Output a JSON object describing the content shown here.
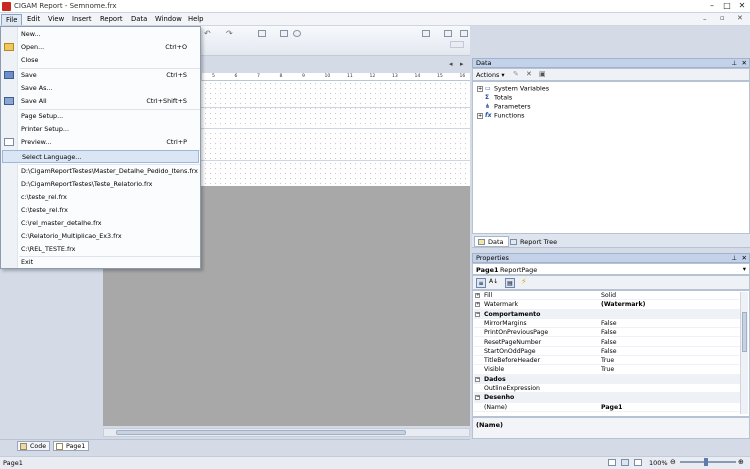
{
  "window": {
    "title": "CIGAM Report - Semnome.frx"
  },
  "menubar": {
    "items": [
      "File",
      "Edit",
      "View",
      "Insert",
      "Report",
      "Data",
      "Window",
      "Help"
    ]
  },
  "file_menu": {
    "items": [
      {
        "label": "New...",
        "shortcut": ""
      },
      {
        "label": "Open...",
        "shortcut": "Ctrl+O"
      },
      {
        "label": "Close",
        "shortcut": ""
      },
      {
        "label": "Save",
        "shortcut": "Ctrl+S"
      },
      {
        "label": "Save As...",
        "shortcut": ""
      },
      {
        "label": "Save All",
        "shortcut": "Ctrl+Shift+S"
      },
      {
        "label": "Page Setup...",
        "shortcut": ""
      },
      {
        "label": "Printer Setup...",
        "shortcut": ""
      },
      {
        "label": "Preview...",
        "shortcut": "Ctrl+P"
      },
      {
        "label": "Select Language...",
        "shortcut": ""
      }
    ],
    "recent": [
      "D:\\CigamReportTestes\\Master_Detalhe_Pedido_Itens.frx",
      "D:\\CigamReportTestes\\Teste_Relatorio.frx",
      "c:\\teste_rel.frx",
      "C:\\teste_rel.frx",
      "C:\\rel_master_detalhe.frx",
      "C:\\Relatorio_Multiplicao_Ex3.frx",
      "C:\\REL_TESTE.frx"
    ],
    "exit": "Exit"
  },
  "ruler": {
    "ticks": [
      "5",
      "6",
      "7",
      "8",
      "9",
      "10",
      "11",
      "12",
      "13",
      "14",
      "15",
      "16"
    ]
  },
  "data_panel": {
    "title": "Data",
    "actions_label": "Actions",
    "tree": [
      "System Variables",
      "Totals",
      "Parameters",
      "Functions"
    ]
  },
  "bottom_tabs": {
    "data": "Data",
    "report_tree": "Report Tree"
  },
  "properties": {
    "title": "Properties",
    "object_name": "Page1",
    "object_type": "ReportPage",
    "rows": [
      {
        "name": "Fill",
        "value": "Solid",
        "kind": "expand"
      },
      {
        "name": "Watermark",
        "value": "(Watermark)",
        "kind": "expand",
        "bold": true
      },
      {
        "name": "Comportamento",
        "value": "",
        "kind": "cat"
      },
      {
        "name": "MirrorMargins",
        "value": "False",
        "kind": "prop"
      },
      {
        "name": "PrintOnPreviousPage",
        "value": "False",
        "kind": "prop"
      },
      {
        "name": "ResetPageNumber",
        "value": "False",
        "kind": "prop"
      },
      {
        "name": "StartOnOddPage",
        "value": "False",
        "kind": "prop"
      },
      {
        "name": "TitleBeforeHeader",
        "value": "True",
        "kind": "prop"
      },
      {
        "name": "Visible",
        "value": "True",
        "kind": "prop"
      },
      {
        "name": "Dados",
        "value": "",
        "kind": "cat"
      },
      {
        "name": "OutlineExpression",
        "value": "",
        "kind": "prop"
      },
      {
        "name": "Desenho",
        "value": "",
        "kind": "cat"
      },
      {
        "name": "(Name)",
        "value": "Page1",
        "kind": "prop",
        "bold": true
      }
    ],
    "description": "(Name)"
  },
  "designer_tabs": {
    "code": "Code",
    "page": "Page1"
  },
  "statusbar": {
    "left": "Page1",
    "zoom": "100%"
  },
  "colors": {
    "accent": "#c3d2e8",
    "highlight": "#dbe6f5",
    "workspace": "#a8a8a8"
  }
}
